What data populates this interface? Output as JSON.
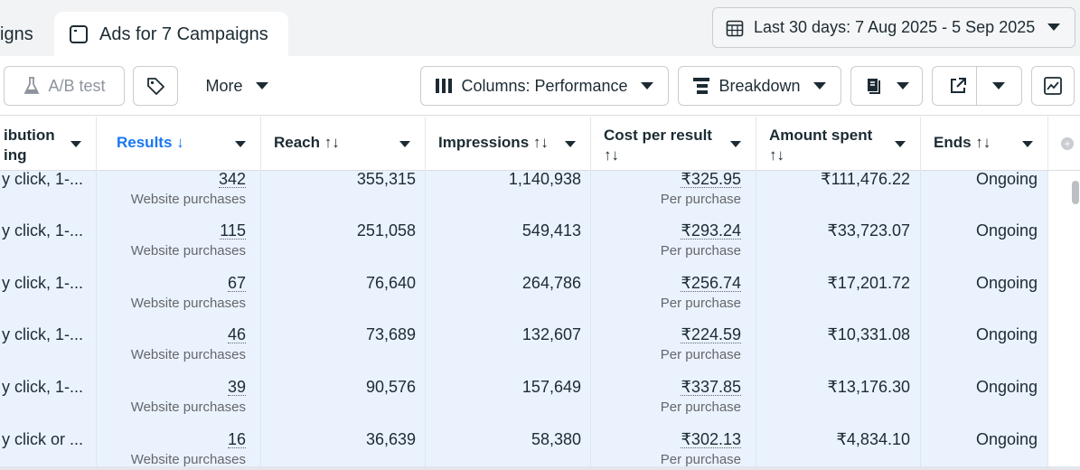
{
  "tabs": {
    "prev_label": "igns",
    "active_label": "Ads for 7 Campaigns"
  },
  "date_range": {
    "label": "Last 30 days: 7 Aug 2025 - 5 Sep 2025"
  },
  "toolbar": {
    "ab_test": "A/B test",
    "more": "More",
    "columns": "Columns: Performance",
    "breakdown": "Breakdown"
  },
  "columns": {
    "attribution_line1": "ibution",
    "attribution_line2": "ing",
    "results": "Results",
    "results_sort": "↓",
    "reach": "Reach",
    "reach_sort": "↑↓",
    "impressions": "Impressions",
    "impressions_sort": "↑↓",
    "cost_per_result": "Cost per result",
    "cost_sort": "↑↓",
    "amount_spent": "Amount spent",
    "amount_sort": "↑↓",
    "ends": "Ends",
    "ends_sort": "↑↓"
  },
  "rows": [
    {
      "attribution": "y click, 1-...",
      "results": "342",
      "results_sub": "Website purchases",
      "reach": "355,315",
      "impressions": "1,140,938",
      "cpr": "₹325.95",
      "cpr_sub": "Per purchase",
      "spent": "₹111,476.22",
      "ends": "Ongoing"
    },
    {
      "attribution": "y click, 1-...",
      "results": "115",
      "results_sub": "Website purchases",
      "reach": "251,058",
      "impressions": "549,413",
      "cpr": "₹293.24",
      "cpr_sub": "Per purchase",
      "spent": "₹33,723.07",
      "ends": "Ongoing"
    },
    {
      "attribution": "y click, 1-...",
      "results": "67",
      "results_sub": "Website purchases",
      "reach": "76,640",
      "impressions": "264,786",
      "cpr": "₹256.74",
      "cpr_sub": "Per purchase",
      "spent": "₹17,201.72",
      "ends": "Ongoing"
    },
    {
      "attribution": "y click, 1-...",
      "results": "46",
      "results_sub": "Website purchases",
      "reach": "73,689",
      "impressions": "132,607",
      "cpr": "₹224.59",
      "cpr_sub": "Per purchase",
      "spent": "₹10,331.08",
      "ends": "Ongoing"
    },
    {
      "attribution": "y click, 1-...",
      "results": "39",
      "results_sub": "Website purchases",
      "reach": "90,576",
      "impressions": "157,649",
      "cpr": "₹337.85",
      "cpr_sub": "Per purchase",
      "spent": "₹13,176.30",
      "ends": "Ongoing"
    },
    {
      "attribution": "y click or ...",
      "results": "16",
      "results_sub": "Website purchases",
      "reach": "36,639",
      "impressions": "58,380",
      "cpr": "₹302.13",
      "cpr_sub": "Per purchase",
      "spent": "₹4,834.10",
      "ends": "Ongoing"
    }
  ],
  "icons": {
    "tab": "window-icon",
    "date": "calendar-icon",
    "ab": "flask-icon",
    "tag": "tag-icon",
    "columns": "columns-icon",
    "breakdown": "breakdown-icon",
    "reports": "reports-icon",
    "export": "export-icon",
    "chart": "chart-icon"
  },
  "colors": {
    "accent": "#1877f2",
    "row_bg": "#eaf2fd"
  }
}
